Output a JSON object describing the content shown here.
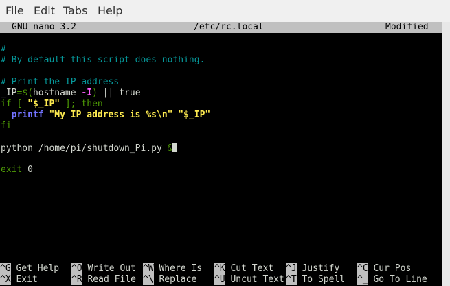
{
  "menubar": {
    "items": [
      "File",
      "Edit",
      "Tabs",
      "Help"
    ]
  },
  "nano": {
    "version": "GNU nano 3.2",
    "filename": "/etc/rc.local",
    "status": "Modified"
  },
  "editor": {
    "line1": "#",
    "line2": "# By default this script does nothing.",
    "line3": "# Print the IP address",
    "line4": {
      "a": "_IP",
      "b": "=",
      "c": "$(",
      "d": "hostname ",
      "e": "-I",
      "f": ")",
      "g": " || true"
    },
    "line5": {
      "a": "if [ ",
      "b": "\"$_IP\"",
      "c": " ]; then"
    },
    "line6": {
      "indent": "  ",
      "a": "printf",
      "b": " ",
      "c": "\"My IP address is %s\\n\"",
      "d": " ",
      "e": "\"$_IP\""
    },
    "line7": "fi",
    "line8": {
      "a": "python /home/pi/shutdown_Pi.py ",
      "b": "&"
    },
    "line9": {
      "a": "exit",
      "b": " 0"
    }
  },
  "shortcuts": {
    "row1": [
      {
        "key": "^G",
        "label": "Get Help"
      },
      {
        "key": "^O",
        "label": "Write Out"
      },
      {
        "key": "^W",
        "label": "Where Is"
      },
      {
        "key": "^K",
        "label": "Cut Text"
      },
      {
        "key": "^J",
        "label": "Justify"
      },
      {
        "key": "^C",
        "label": "Cur Pos"
      }
    ],
    "row2": [
      {
        "key": "^X",
        "label": "Exit"
      },
      {
        "key": "^R",
        "label": "Read File"
      },
      {
        "key": "^\\",
        "label": "Replace"
      },
      {
        "key": "^U",
        "label": "Uncut Text"
      },
      {
        "key": "^T",
        "label": "To Spell"
      },
      {
        "key": "^_",
        "label": "Go To Line"
      }
    ]
  }
}
